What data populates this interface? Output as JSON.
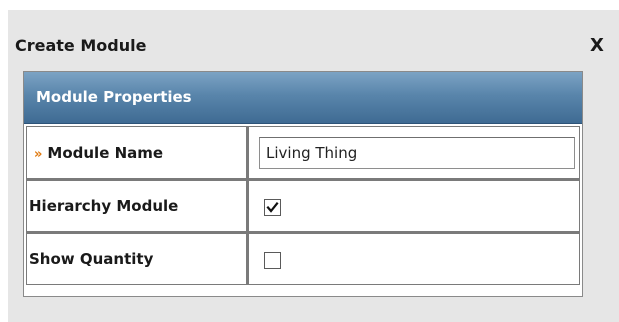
{
  "dialog": {
    "title": "Create Module",
    "close_label": "X"
  },
  "panel": {
    "title": "Module Properties"
  },
  "fields": {
    "module_name": {
      "required_marker": "»",
      "label": "Module Name",
      "value": "Living Thing"
    },
    "hierarchy_module": {
      "label": "Hierarchy Module",
      "checked": true
    },
    "show_quantity": {
      "label": "Show Quantity",
      "checked": false
    }
  }
}
